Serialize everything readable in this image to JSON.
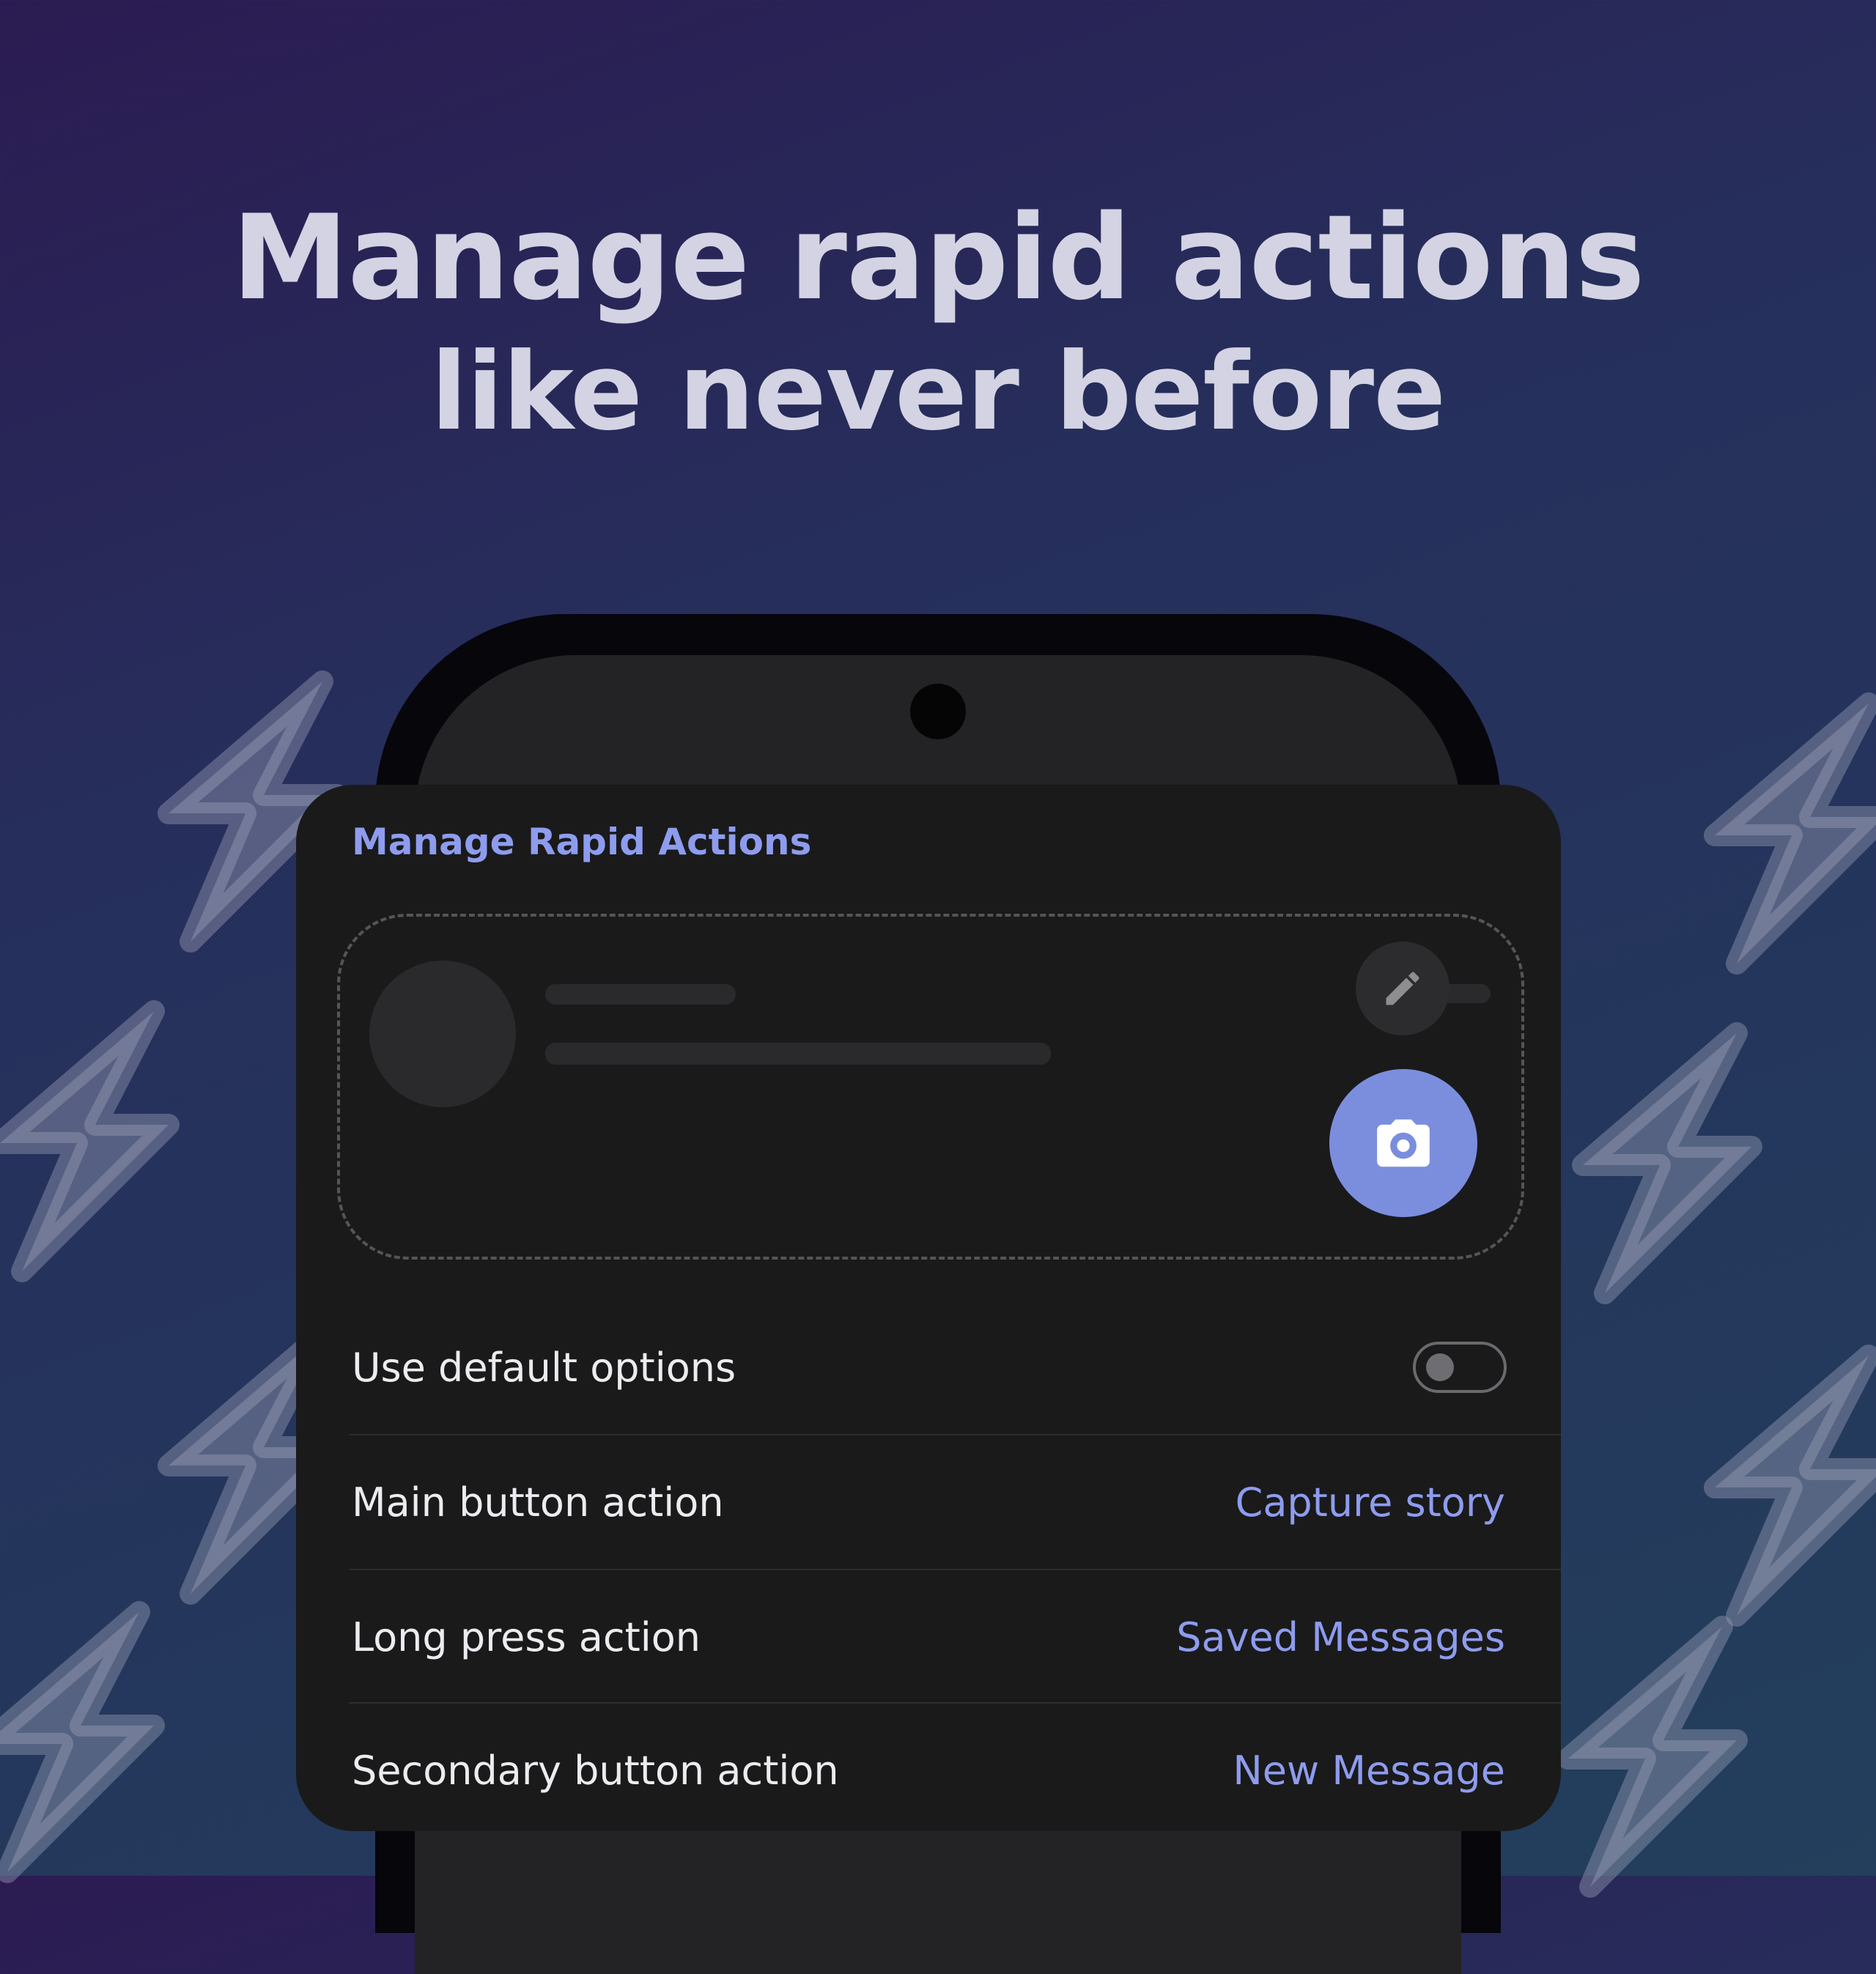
{
  "headline": {
    "line1": "Manage rapid actions",
    "line2": "like never before"
  },
  "sheet": {
    "title": "Manage Rapid Actions",
    "preview": {
      "edit_icon": "pencil-icon",
      "fab_icon": "camera-icon"
    },
    "settings": [
      {
        "label": "Use default options",
        "type": "toggle",
        "on": false
      },
      {
        "label": "Main button action",
        "value": "Capture story"
      },
      {
        "label": "Long press action",
        "value": "Saved Messages"
      },
      {
        "label": "Secondary button action",
        "value": "New Message"
      }
    ]
  },
  "colors": {
    "accent": "#8e9cee",
    "fab": "#7b8ede",
    "sheet_bg": "#1a1a1b",
    "bolt": "#9aa0b8"
  }
}
